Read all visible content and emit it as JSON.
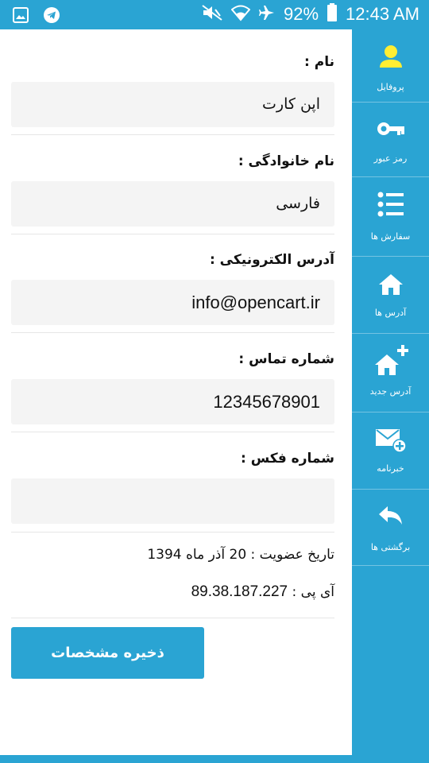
{
  "status_bar": {
    "battery": "92%",
    "time": "12:43 AM"
  },
  "form": {
    "first_name": {
      "label": "نام :",
      "value": "اپن کارت"
    },
    "last_name": {
      "label": "نام خانوادگی :",
      "value": "فارسی"
    },
    "email": {
      "label": "آدرس الکترونیکی :",
      "value": "info@opencart.ir"
    },
    "phone": {
      "label": "شماره تماس :",
      "value": "12345678901"
    },
    "fax": {
      "label": "شماره فکس :",
      "value": ""
    }
  },
  "info": {
    "membership_label": "تاریخ عضویت :",
    "membership_date": "20 آذر ماه  1394",
    "ip_label": "آی پی :",
    "ip_value": "89.38.187.227"
  },
  "save_button": "ذخیره مشخصات",
  "sidebar": {
    "items": [
      {
        "label": "پروفایل",
        "icon": "user-icon",
        "icon_color": "#ffee33"
      },
      {
        "label": "رمز عبور",
        "icon": "key-icon",
        "icon_color": "#ffffff"
      },
      {
        "label": "سفارش ها",
        "icon": "list-icon",
        "icon_color": "#ffffff"
      },
      {
        "label": "آدرس ها",
        "icon": "home-icon",
        "icon_color": "#ffffff"
      },
      {
        "label": "آدرس جدید",
        "icon": "home-add-icon",
        "icon_color": "#ffffff"
      },
      {
        "label": "خبرنامه",
        "icon": "mail-add-icon",
        "icon_color": "#ffffff"
      },
      {
        "label": "برگشتی ها",
        "icon": "reply-icon",
        "icon_color": "#ffffff"
      }
    ]
  },
  "colors": {
    "accent": "#2aa4d3",
    "field_bg": "#f4f4f4",
    "active_icon": "#ffee33"
  }
}
